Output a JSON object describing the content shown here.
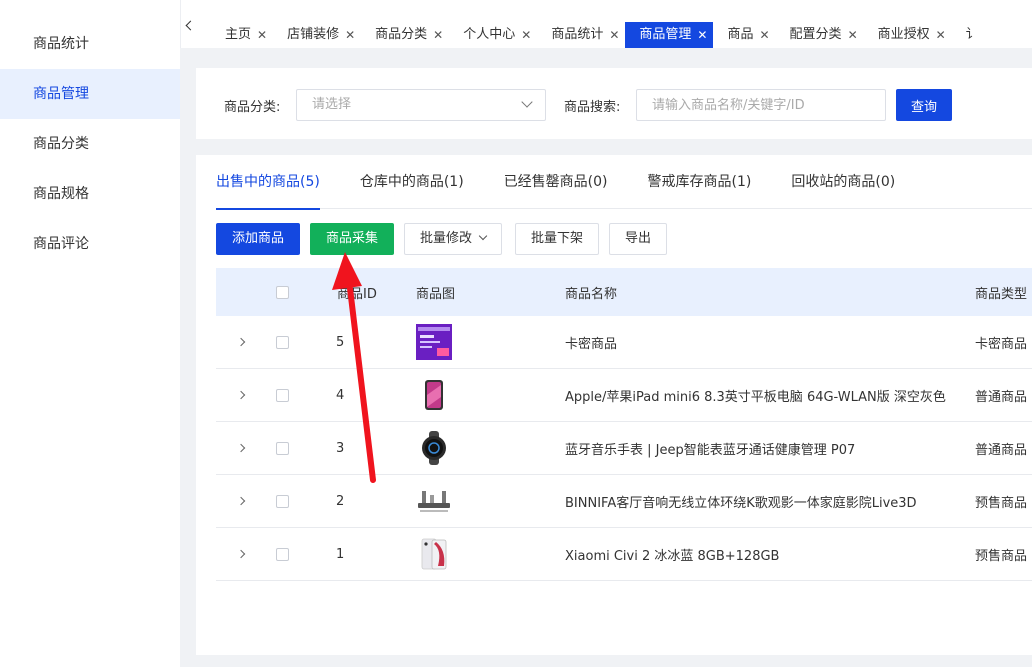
{
  "sidebar": {
    "items": [
      {
        "label": "商品统计",
        "active": false
      },
      {
        "label": "商品管理",
        "active": true
      },
      {
        "label": "商品分类",
        "active": false
      },
      {
        "label": "商品规格",
        "active": false
      },
      {
        "label": "商品评论",
        "active": false
      }
    ]
  },
  "tabbar": {
    "tabs": [
      {
        "label": "主页",
        "active": false
      },
      {
        "label": "店铺装修",
        "active": false
      },
      {
        "label": "商品分类",
        "active": false
      },
      {
        "label": "个人中心",
        "active": false
      },
      {
        "label": "商品统计",
        "active": false
      },
      {
        "label": "商品管理",
        "active": true
      },
      {
        "label": "商品",
        "active": false
      },
      {
        "label": "配置分类",
        "active": false
      },
      {
        "label": "商业授权",
        "active": false
      },
      {
        "label": "讠",
        "active": false
      }
    ],
    "close_glyph": "✕"
  },
  "filter": {
    "category_label": "商品分类:",
    "category_placeholder": "请选择",
    "search_label": "商品搜索:",
    "search_placeholder": "请输入商品名称/关键字/ID",
    "query_label": "查询"
  },
  "status_tabs": [
    {
      "label": "出售中的商品(5)",
      "active": true
    },
    {
      "label": "仓库中的商品(1)",
      "active": false
    },
    {
      "label": "已经售罄商品(0)",
      "active": false
    },
    {
      "label": "警戒库存商品(1)",
      "active": false
    },
    {
      "label": "回收站的商品(0)",
      "active": false
    }
  ],
  "actions": {
    "add": "添加商品",
    "collect": "商品采集",
    "batch_edit": "批量修改",
    "batch_offline": "批量下架",
    "export": "导出"
  },
  "table": {
    "headers": {
      "id": "商品ID",
      "image": "商品图",
      "name": "商品名称",
      "type": "商品类型"
    },
    "rows": [
      {
        "id": "5",
        "image": "card-thumbnail",
        "name": "卡密商品",
        "type": "卡密商品"
      },
      {
        "id": "4",
        "image": "ipad-thumbnail",
        "name": "Apple/苹果iPad mini6 8.3英寸平板电脑 64G-WLAN版 深空灰色",
        "type": "普通商品"
      },
      {
        "id": "3",
        "image": "watch-thumbnail",
        "name": "蓝牙音乐手表 | Jeep智能表蓝牙通话健康管理 P07",
        "type": "普通商品"
      },
      {
        "id": "2",
        "image": "speaker-thumbnail",
        "name": "BINNIFA客厅音响无线立体环绕K歌观影一体家庭影院Live3D",
        "type": "预售商品"
      },
      {
        "id": "1",
        "image": "phone-thumbnail",
        "name": "Xiaomi Civi 2 冰冰蓝 8GB+128GB",
        "type": "预售商品"
      }
    ]
  },
  "colors": {
    "primary": "#1448e0",
    "green": "#12b05a",
    "annotation_arrow": "#f0141e"
  }
}
